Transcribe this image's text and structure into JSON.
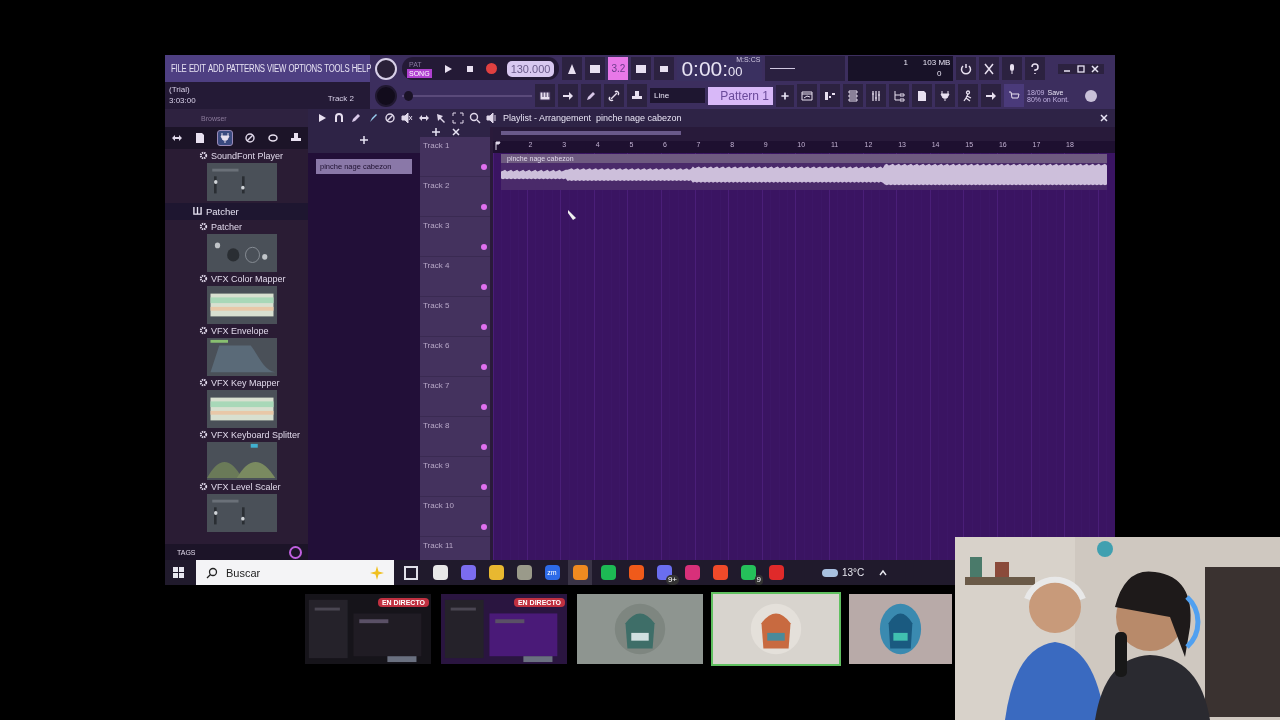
{
  "menu": [
    "FILE",
    "EDIT",
    "ADD",
    "PATTERNS",
    "VIEW",
    "OPTIONS",
    "TOOLS",
    "HELP"
  ],
  "hint": {
    "line1": "(Trial)",
    "line2": "3:03:00",
    "track": "Track 2"
  },
  "transport": {
    "modes": [
      {
        "label": "PAT",
        "selected": false
      },
      {
        "label": "SONG",
        "selected": true
      }
    ],
    "recording": true,
    "tempo": "130.000"
  },
  "toggles": [
    {
      "on": false
    },
    {
      "on": false
    },
    {
      "on": true,
      "label": "3.2"
    },
    {
      "on": false
    },
    {
      "on": false
    }
  ],
  "time": {
    "main": "0:00:",
    "small": "00",
    "unit": "M:S:CS"
  },
  "monitor": {
    "voices": "1",
    "memory": "103 MB",
    "polyphony": "0"
  },
  "master": {
    "level": 0
  },
  "snap": "Line",
  "pattern": "Pattern 1",
  "news": {
    "line1": "18/09",
    "line1b": "Save",
    "line2": "80% on Kont."
  },
  "browser": {
    "title": "Browser",
    "items": [
      {
        "kind": "plugin",
        "label": "SoundFont Player"
      },
      {
        "kind": "folder",
        "label": "Patcher",
        "selected": true
      },
      {
        "kind": "plugin",
        "label": "Patcher"
      },
      {
        "kind": "plugin",
        "label": "VFX Color Mapper"
      },
      {
        "kind": "plugin",
        "label": "VFX Envelope"
      },
      {
        "kind": "plugin",
        "label": "VFX Key Mapper"
      },
      {
        "kind": "plugin",
        "label": "VFX Keyboard Splitter"
      },
      {
        "kind": "plugin",
        "label": "VFX Level Scaler"
      }
    ],
    "tags": "TAGS"
  },
  "playlist": {
    "title": "Playlist - Arrangement",
    "breadcrumb": "pinche nage cabezon",
    "picker_clip": "pinche nage cabezon",
    "clip": "pinche nage cabezon",
    "ruler": [
      "2",
      "3",
      "4",
      "5",
      "6",
      "7",
      "8",
      "9",
      "10",
      "11",
      "12",
      "13",
      "14",
      "15",
      "16",
      "17",
      "18"
    ],
    "tracks": [
      "Track 1",
      "Track 2",
      "Track 3",
      "Track 4",
      "Track 5",
      "Track 6",
      "Track 7",
      "Track 8",
      "Track 9",
      "Track 10",
      "Track 11"
    ]
  },
  "taskbar": {
    "search": "Buscar",
    "apps": [
      {
        "color": "#e8e8e8",
        "active": false
      },
      {
        "color": "#7b6cf0",
        "active": false
      },
      {
        "color": "#e8b830",
        "active": false
      },
      {
        "color": "#9a9a8a",
        "active": false
      },
      {
        "color": "#2d6ae8",
        "label": "zm",
        "active": false
      },
      {
        "color": "#f08a20",
        "active": true
      },
      {
        "color": "#1db954",
        "active": false
      },
      {
        "color": "#f05a1a",
        "active": false
      },
      {
        "color": "#6a6ef0",
        "badge": "9+",
        "active": false
      },
      {
        "color": "#d8307a",
        "active": false
      },
      {
        "color": "#f04a2a",
        "active": false
      },
      {
        "color": "#25c05a",
        "badge": "9",
        "active": false
      },
      {
        "color": "#e02a2a",
        "active": false
      }
    ],
    "weather": "13°C"
  },
  "thumbnails": [
    {
      "kind": "screen",
      "live": "EN DIRECTO",
      "selected": false
    },
    {
      "kind": "screen",
      "live": "EN DIRECTO",
      "selected": false
    },
    {
      "kind": "avatar",
      "selected": false
    },
    {
      "kind": "avatar",
      "selected": true
    },
    {
      "kind": "avatar",
      "selected": false
    }
  ]
}
